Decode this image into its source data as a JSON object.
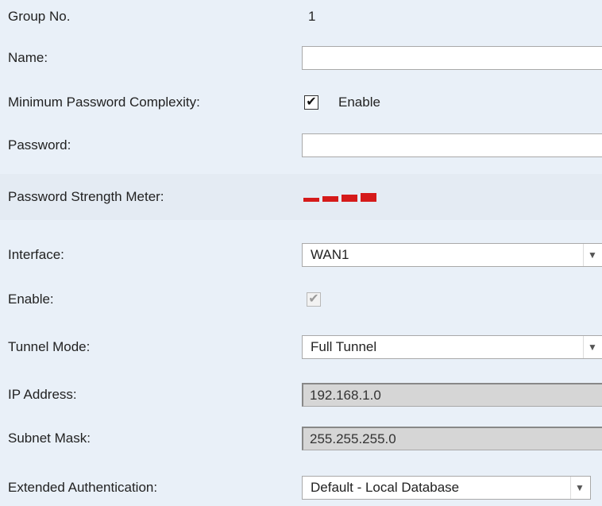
{
  "form": {
    "group_no": {
      "label": "Group No.",
      "value": "1"
    },
    "name": {
      "label": "Name:",
      "value": ""
    },
    "min_password_complexity": {
      "label": "Minimum Password Complexity:",
      "checkbox_label": "Enable",
      "checked": true
    },
    "password": {
      "label": "Password:",
      "value": ""
    },
    "password_strength": {
      "label": "Password Strength Meter:",
      "segments": 4,
      "color": "#d51a1a"
    },
    "interface": {
      "label": "Interface:",
      "selected": "WAN1"
    },
    "enable": {
      "label": "Enable:",
      "checked": true,
      "disabled": true
    },
    "tunnel_mode": {
      "label": "Tunnel Mode:",
      "selected": "Full Tunnel"
    },
    "ip_address": {
      "label": "IP Address:",
      "value": "192.168.1.0",
      "disabled": true
    },
    "subnet_mask": {
      "label": "Subnet Mask:",
      "value": "255.255.255.0",
      "disabled": true
    },
    "extended_auth": {
      "label": "Extended Authentication:",
      "selected": "Default - Local Database"
    }
  },
  "icons": {
    "check": "check-icon",
    "dropdown": "chevron-down-icon"
  }
}
